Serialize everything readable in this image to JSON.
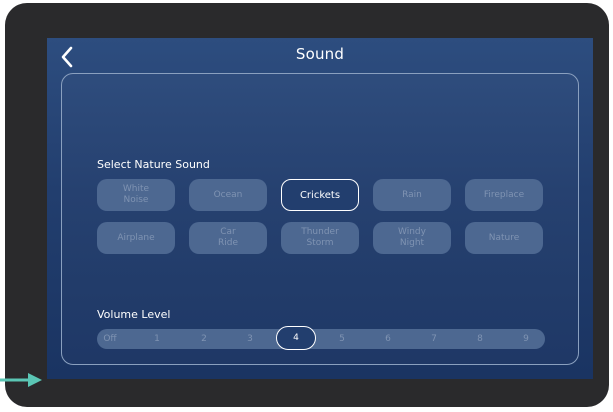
{
  "header": {
    "title": "Sound",
    "back_icon": "chevron-left-icon"
  },
  "nature_sound": {
    "label": "Select Nature Sound",
    "selected": "Crickets",
    "options": [
      "White\nNoise",
      "Ocean",
      "Crickets",
      "Rain",
      "Fireplace",
      "Airplane",
      "Car\nRide",
      "Thunder\nStorm",
      "Windy\nNight",
      "Nature"
    ]
  },
  "volume": {
    "label": "Volume Level",
    "selected": "4",
    "levels": [
      "Off",
      "1",
      "2",
      "3",
      "4",
      "5",
      "6",
      "7",
      "8",
      "9"
    ]
  },
  "colors": {
    "accent_arrow": "#5bc6b5",
    "screen_background": "#223e6e",
    "button_background": "#4d6891",
    "inactive_text": "#7f93b2",
    "selected_border": "#ffffff"
  }
}
